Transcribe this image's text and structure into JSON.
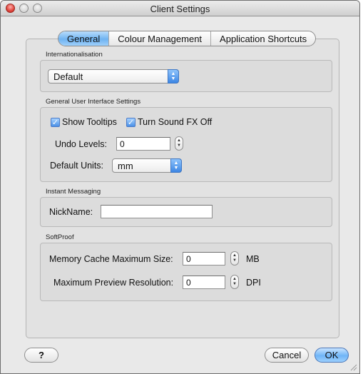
{
  "window": {
    "title": "Client Settings"
  },
  "tabs": [
    "General",
    "Colour Management",
    "Application Shortcuts"
  ],
  "sections": {
    "internationalisation": {
      "label": "Internationalisation",
      "language_value": "Default"
    },
    "general_ui": {
      "label": "General User Interface Settings",
      "show_tooltips_label": "Show Tooltips",
      "show_tooltips_checked": true,
      "sound_fx_label": "Turn Sound FX Off",
      "sound_fx_checked": true,
      "undo_label": "Undo Levels:",
      "undo_value": "0",
      "units_label": "Default Units:",
      "units_value": "mm"
    },
    "instant_messaging": {
      "label": "Instant Messaging",
      "nickname_label": "NickName:",
      "nickname_value": ""
    },
    "softproof": {
      "label": "SoftProof",
      "cache_label": "Memory Cache Maximum Size:",
      "cache_value": "0",
      "cache_unit": "MB",
      "preview_label": "Maximum Preview Resolution:",
      "preview_value": "0",
      "preview_unit": "DPI"
    }
  },
  "buttons": {
    "help": "?",
    "cancel": "Cancel",
    "ok": "OK"
  },
  "icons": {
    "close": "close-icon",
    "minimize": "minimize-icon",
    "zoom": "zoom-icon",
    "help": "help-icon",
    "popup": "chevron-updown-icon",
    "stepper": "stepper-icon",
    "check": "checkmark-icon",
    "resize": "resize-grip-icon"
  },
  "colors": {
    "accent": "#6fb3f1",
    "close": "#e0443c"
  }
}
